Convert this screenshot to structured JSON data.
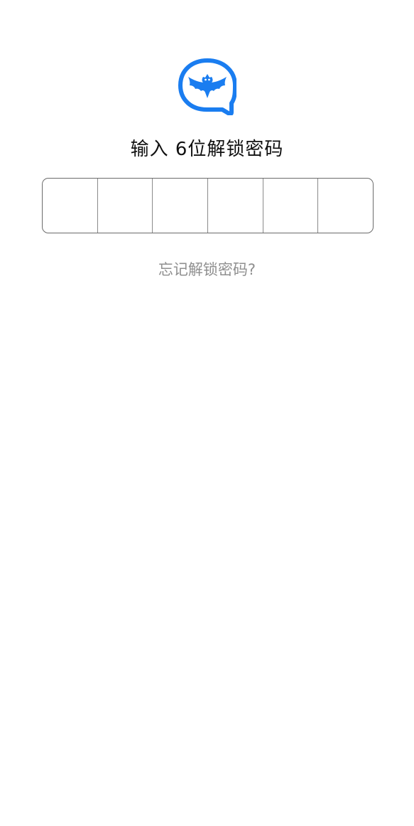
{
  "app": {
    "logo_icon": "bat-chat-bubble-icon",
    "brand_color": "#1a7df0"
  },
  "lock": {
    "title": "输入 6位解锁密码",
    "pin_length": 6,
    "pin_digits": [
      "",
      "",
      "",
      "",
      "",
      ""
    ],
    "forgot_link": "忘记解锁密码?"
  }
}
